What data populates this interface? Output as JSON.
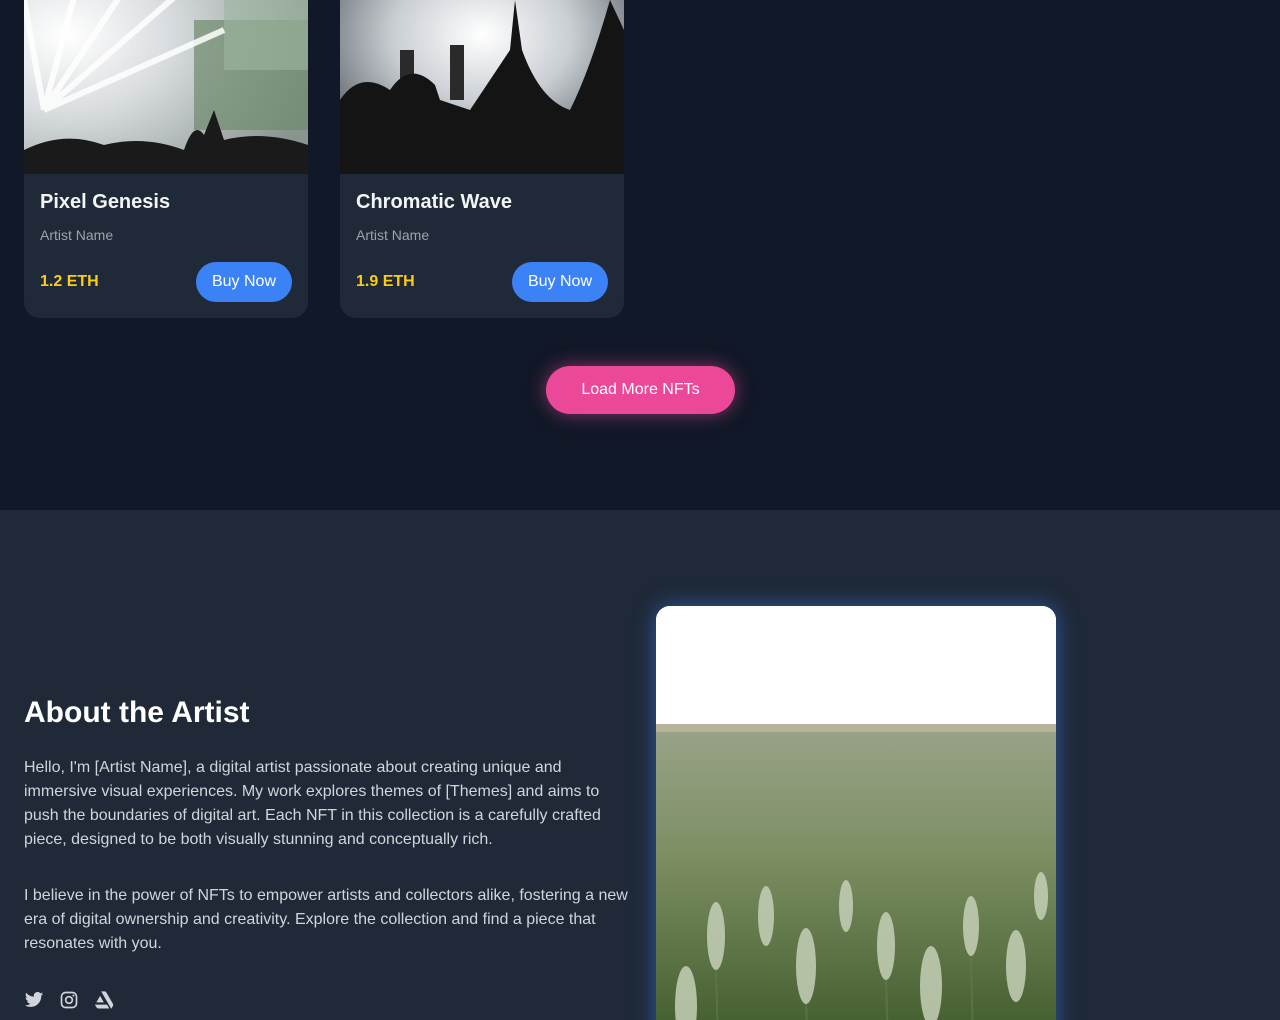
{
  "gallery": {
    "cards": [
      {
        "title": "Pixel Genesis",
        "artist": "Artist Name",
        "price": "1.2 ETH",
        "buy_label": "Buy Now"
      },
      {
        "title": "Chromatic Wave",
        "artist": "Artist Name",
        "price": "1.9 ETH",
        "buy_label": "Buy Now"
      }
    ],
    "load_more_label": "Load More NFTs"
  },
  "about": {
    "heading": "About the Artist",
    "paragraphs": [
      "Hello, I'm [Artist Name], a digital artist passionate about creating unique and immersive visual experiences. My work explores themes of [Themes] and aims to push the boundaries of digital art. Each NFT in this collection is a carefully crafted piece, designed to be both visually stunning and conceptually rich.",
      "I believe in the power of NFTs to empower artists and collectors alike, fostering a new era of digital ownership and creativity. Explore the collection and find a piece that resonates with you."
    ],
    "socials": [
      "twitter-icon",
      "instagram-icon",
      "artstation-icon"
    ]
  },
  "colors": {
    "page_bg": "#111827",
    "card_bg": "#1f2937",
    "price": "#facc15",
    "buy_button": "#3b82f6",
    "load_more": "#ec4899"
  }
}
